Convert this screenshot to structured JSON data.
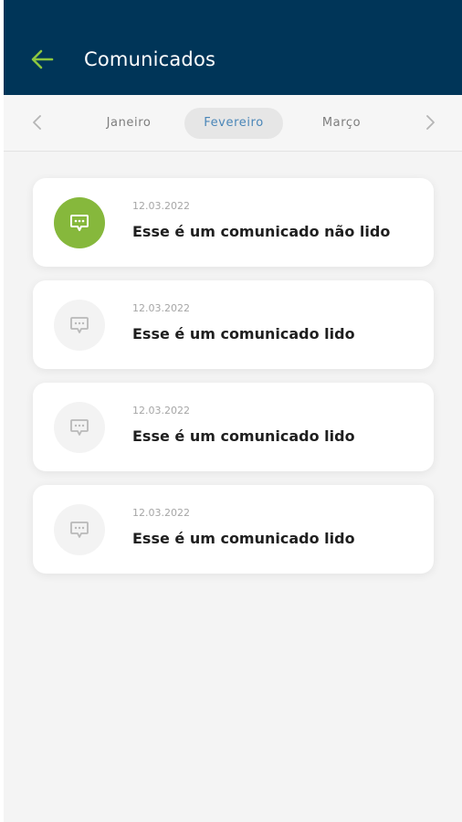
{
  "header": {
    "title": "Comunicados",
    "back_icon": "arrow-left-icon",
    "accent_color": "#8cc63f",
    "background_color": "#003558"
  },
  "months": {
    "prev_icon": "chevron-left-icon",
    "next_icon": "chevron-right-icon",
    "items": [
      {
        "label": "Janeiro",
        "selected": false
      },
      {
        "label": "Fevereiro",
        "selected": true
      },
      {
        "label": "Março",
        "selected": false
      }
    ]
  },
  "messages": [
    {
      "date": "12.03.2022",
      "text": "Esse é um comunicado não lido",
      "read": false,
      "icon": "chat-message-icon"
    },
    {
      "date": "12.03.2022",
      "text": "Esse é um comunicado lido",
      "read": true,
      "icon": "chat-message-icon"
    },
    {
      "date": "12.03.2022",
      "text": "Esse é um comunicado lido",
      "read": true,
      "icon": "chat-message-icon"
    },
    {
      "date": "12.03.2022",
      "text": "Esse é um comunicado lido",
      "read": true,
      "icon": "chat-message-icon"
    }
  ],
  "colors": {
    "unread_icon_bg": "#86b83c",
    "read_icon_bg": "#f3f3f3",
    "selected_month_text": "#4a86b8"
  }
}
